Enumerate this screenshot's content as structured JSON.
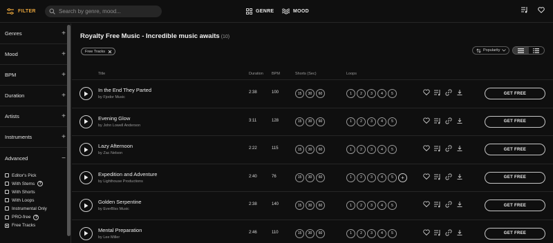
{
  "topbar": {
    "filter_label": "FILTER",
    "search_placeholder": "Search by genre, mood...",
    "genre_label": "GENRE",
    "mood_label": "MOOD"
  },
  "sidebar": {
    "sections": [
      "Genres",
      "Mood",
      "BPM",
      "Duration",
      "Artists",
      "Instruments"
    ],
    "advanced": {
      "label": "Advanced",
      "items": [
        {
          "label": "Editor's Pick",
          "checked": false,
          "help": false
        },
        {
          "label": "With Stems",
          "checked": false,
          "help": true
        },
        {
          "label": "With Shorts",
          "checked": false,
          "help": false
        },
        {
          "label": "With Loops",
          "checked": false,
          "help": false
        },
        {
          "label": "Instrumental Only",
          "checked": false,
          "help": false
        },
        {
          "label": "PRO-free",
          "checked": false,
          "help": true
        },
        {
          "label": "Free Tracks",
          "checked": true,
          "help": false
        }
      ]
    }
  },
  "main": {
    "title": "Royalty Free Music - Incredible music awaits",
    "count": "(10)",
    "chip_label": "Free Tracks",
    "sort_label": "Popularity",
    "columns": {
      "title": "Title",
      "duration": "Duration",
      "bpm": "BPM",
      "shorts": "Shorts (Sec)",
      "loops": "Loops"
    },
    "cta_label": "GET FREE",
    "tracks": [
      {
        "title": "In the End They Parted",
        "artist": "by Fjodor Music",
        "duration": "2:38",
        "bpm": "100",
        "shorts": [
          "15",
          "30",
          "60"
        ],
        "loops": [
          "1",
          "2",
          "3",
          "4",
          "5"
        ],
        "more_loops": false
      },
      {
        "title": "Evening Glow",
        "artist": "by John Lowell Anderson",
        "duration": "3:11",
        "bpm": "128",
        "shorts": [
          "15",
          "30",
          "60"
        ],
        "loops": [
          "1",
          "2",
          "3",
          "4",
          "5"
        ],
        "more_loops": false
      },
      {
        "title": "Lazy Afternoon",
        "artist": "by Zac Nelson",
        "duration": "2:22",
        "bpm": "115",
        "shorts": [
          "15",
          "30",
          "60"
        ],
        "loops": [
          "1",
          "2",
          "3",
          "4",
          "5"
        ],
        "more_loops": false
      },
      {
        "title": "Expedition and Adventure",
        "artist": "by Lighthouse Productions",
        "duration": "2:40",
        "bpm": "76",
        "shorts": [
          "15",
          "30",
          "60"
        ],
        "loops": [
          "1",
          "2",
          "3",
          "4",
          "5"
        ],
        "more_loops": true
      },
      {
        "title": "Golden Serpentine",
        "artist": "by EverBlss Music",
        "duration": "2:38",
        "bpm": "140",
        "shorts": [
          "15",
          "30",
          "60"
        ],
        "loops": [
          "1",
          "2",
          "3",
          "4",
          "5"
        ],
        "more_loops": false
      },
      {
        "title": "Mental Preparation",
        "artist": "by Lee Miller",
        "duration": "2:46",
        "bpm": "110",
        "shorts": [
          "15",
          "30",
          "60"
        ],
        "loops": [
          "1",
          "2",
          "3",
          "4",
          "5"
        ],
        "more_loops": false
      }
    ]
  },
  "colors": {
    "accent": "#e8a53c",
    "background": "#0f0f0f",
    "divider": "#262626"
  }
}
